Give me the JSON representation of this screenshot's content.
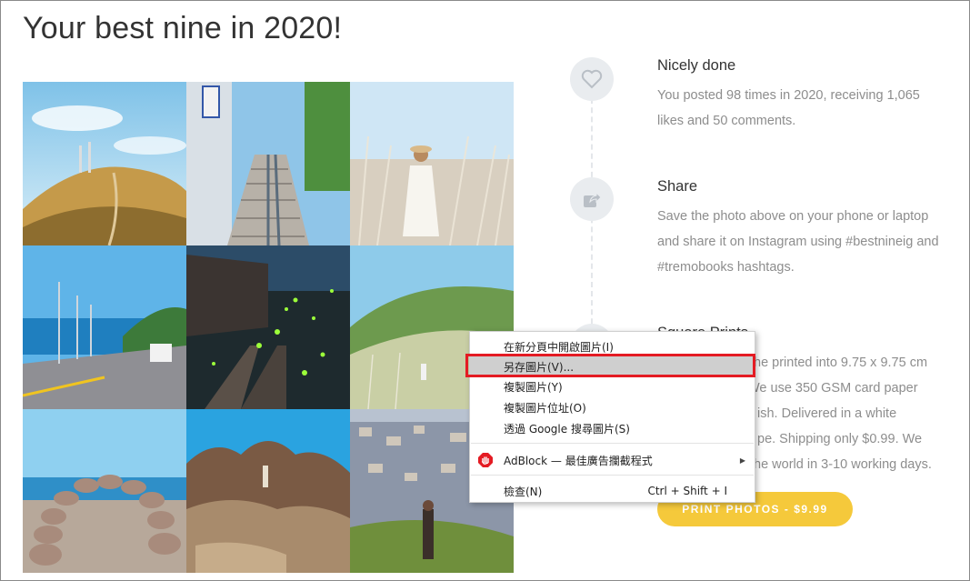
{
  "page": {
    "title": "Your best nine in 2020!"
  },
  "photos": [
    {
      "icon": "hill-lighthouse-photo"
    },
    {
      "icon": "stairs-railway-photo"
    },
    {
      "icon": "woman-pampas-grass-photo"
    },
    {
      "icon": "seaside-highway-photo"
    },
    {
      "icon": "fireflies-railway-night-photo"
    },
    {
      "icon": "grassy-mountain-photo"
    },
    {
      "icon": "stacked-stones-arch-photo"
    },
    {
      "icon": "sea-rocks-photo"
    },
    {
      "icon": "hillside-town-photo"
    }
  ],
  "steps": {
    "done": {
      "title": "Nicely done",
      "text": "You posted 98 times in 2020, receiving 1,065 likes and 50 comments.",
      "icon": "heart-icon"
    },
    "share": {
      "title": "Share",
      "text": "Save the photo above on your phone or laptop and share it on Instagram using #bestnineig and #tremobooks hashtags.",
      "icon": "share-icon"
    },
    "prints": {
      "title_visible": "Square Prints",
      "line1": "he printed into 9.75 x 9.75 cm",
      "line2": "We use 350 GSM card paper",
      "line3": "ish. Delivered in a white",
      "line4": "pe. Shipping only $0.99. We",
      "line5": "the world in 3-10 working days."
    }
  },
  "print_button": {
    "label": "PRINT PHOTOS - $9.99"
  },
  "context_menu": {
    "items": [
      {
        "label": "在新分頁中開啟圖片(I)"
      },
      {
        "label": "另存圖片(V)..."
      },
      {
        "label": "複製圖片(Y)"
      },
      {
        "label": "複製圖片位址(O)"
      },
      {
        "label": "透過 Google 搜尋圖片(S)"
      },
      {
        "label": "AdBlock — 最佳廣告攔截程式"
      },
      {
        "label": "檢查(N)",
        "shortcut": "Ctrl + Shift + I"
      }
    ],
    "highlight_color": "#e41b23"
  },
  "colors": {
    "accent": "#f5c93b",
    "muted_text": "#8d8d8d",
    "icon_bg": "#e9ecef"
  }
}
